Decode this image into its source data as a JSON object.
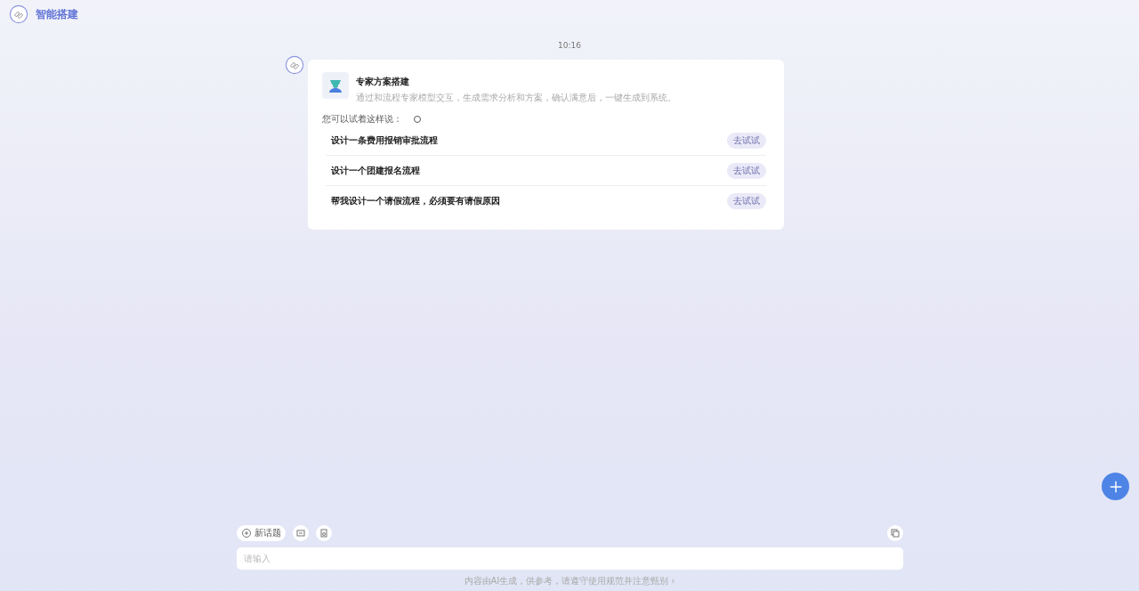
{
  "app": {
    "title": "智能搭建"
  },
  "chat": {
    "time": "10:16",
    "card": {
      "title": "专家方案搭建",
      "description": "通过和流程专家模型交互，生成需求分析和方案，确认满意后，一键生成到系统。",
      "hint": "您可以试着这样说：",
      "suggestions": [
        {
          "text": "设计一条费用报销审批流程",
          "action": "去试试"
        },
        {
          "text": "设计一个团建报名流程",
          "action": "去试试"
        },
        {
          "text": "帮我设计一个请假流程，必须要有请假原因",
          "action": "去试试"
        }
      ]
    }
  },
  "composer": {
    "new_topic": "新话题",
    "placeholder": "请输入"
  },
  "footer": "内容由AI生成，供参考，请遵守使用规范并注意甄别 ›"
}
